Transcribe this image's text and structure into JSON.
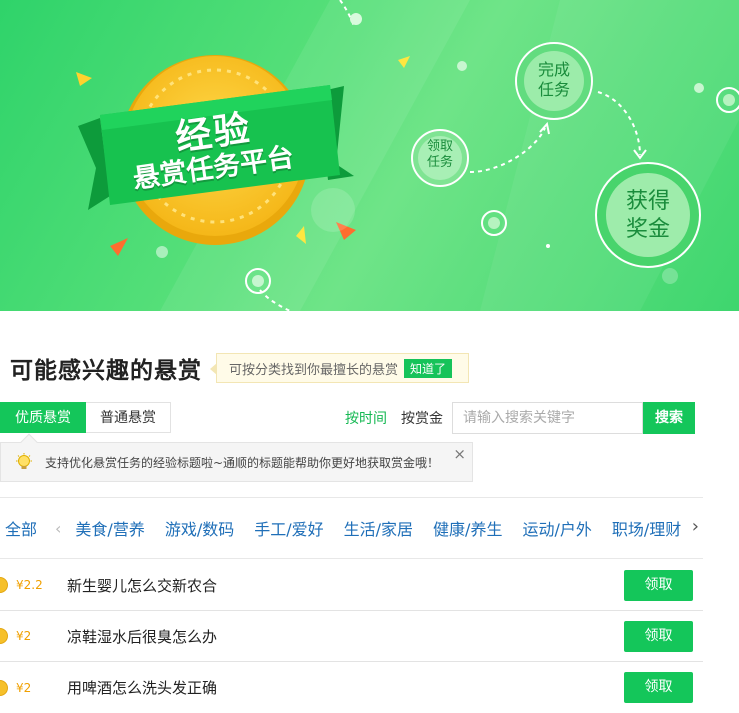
{
  "banner": {
    "title": "经验",
    "subtitle": "悬赏任务平台",
    "step_claim": "领取\n任务",
    "step_complete": "完成\n任务",
    "step_reward": "获得\n奖金"
  },
  "section": {
    "title": "可能感兴趣的悬赏",
    "hint_text": "可按分类找到你最擅长的悬赏",
    "hint_button": "知道了"
  },
  "tabs": [
    {
      "label": "优质悬赏",
      "active": true
    },
    {
      "label": "普通悬赏",
      "active": false
    }
  ],
  "filter": {
    "sort_time": "按时间",
    "sort_reward": "按赏金",
    "search_placeholder": "请输入搜索关键字",
    "search_button": "搜索"
  },
  "tip": {
    "text": "支持优化悬赏任务的经验标题啦~通顺的标题能帮助你更好地获取赏金哦！",
    "close": "×"
  },
  "categories": {
    "all": "全部",
    "items": [
      "美食/营养",
      "游戏/数码",
      "手工/爱好",
      "生活/家居",
      "健康/养生",
      "运动/户外",
      "职场/理财"
    ]
  },
  "tasks": [
    {
      "reward": "¥2.2",
      "title": "新生婴儿怎么交新农合",
      "button": "领取"
    },
    {
      "reward": "¥2",
      "title": "凉鞋湿水后很臭怎么办",
      "button": "领取"
    },
    {
      "reward": "¥2",
      "title": "用啤酒怎么洗头发正确",
      "button": "领取"
    }
  ],
  "colors": {
    "accent": "#14c65a",
    "link": "#1f6fb8",
    "reward": "#f0a000"
  }
}
